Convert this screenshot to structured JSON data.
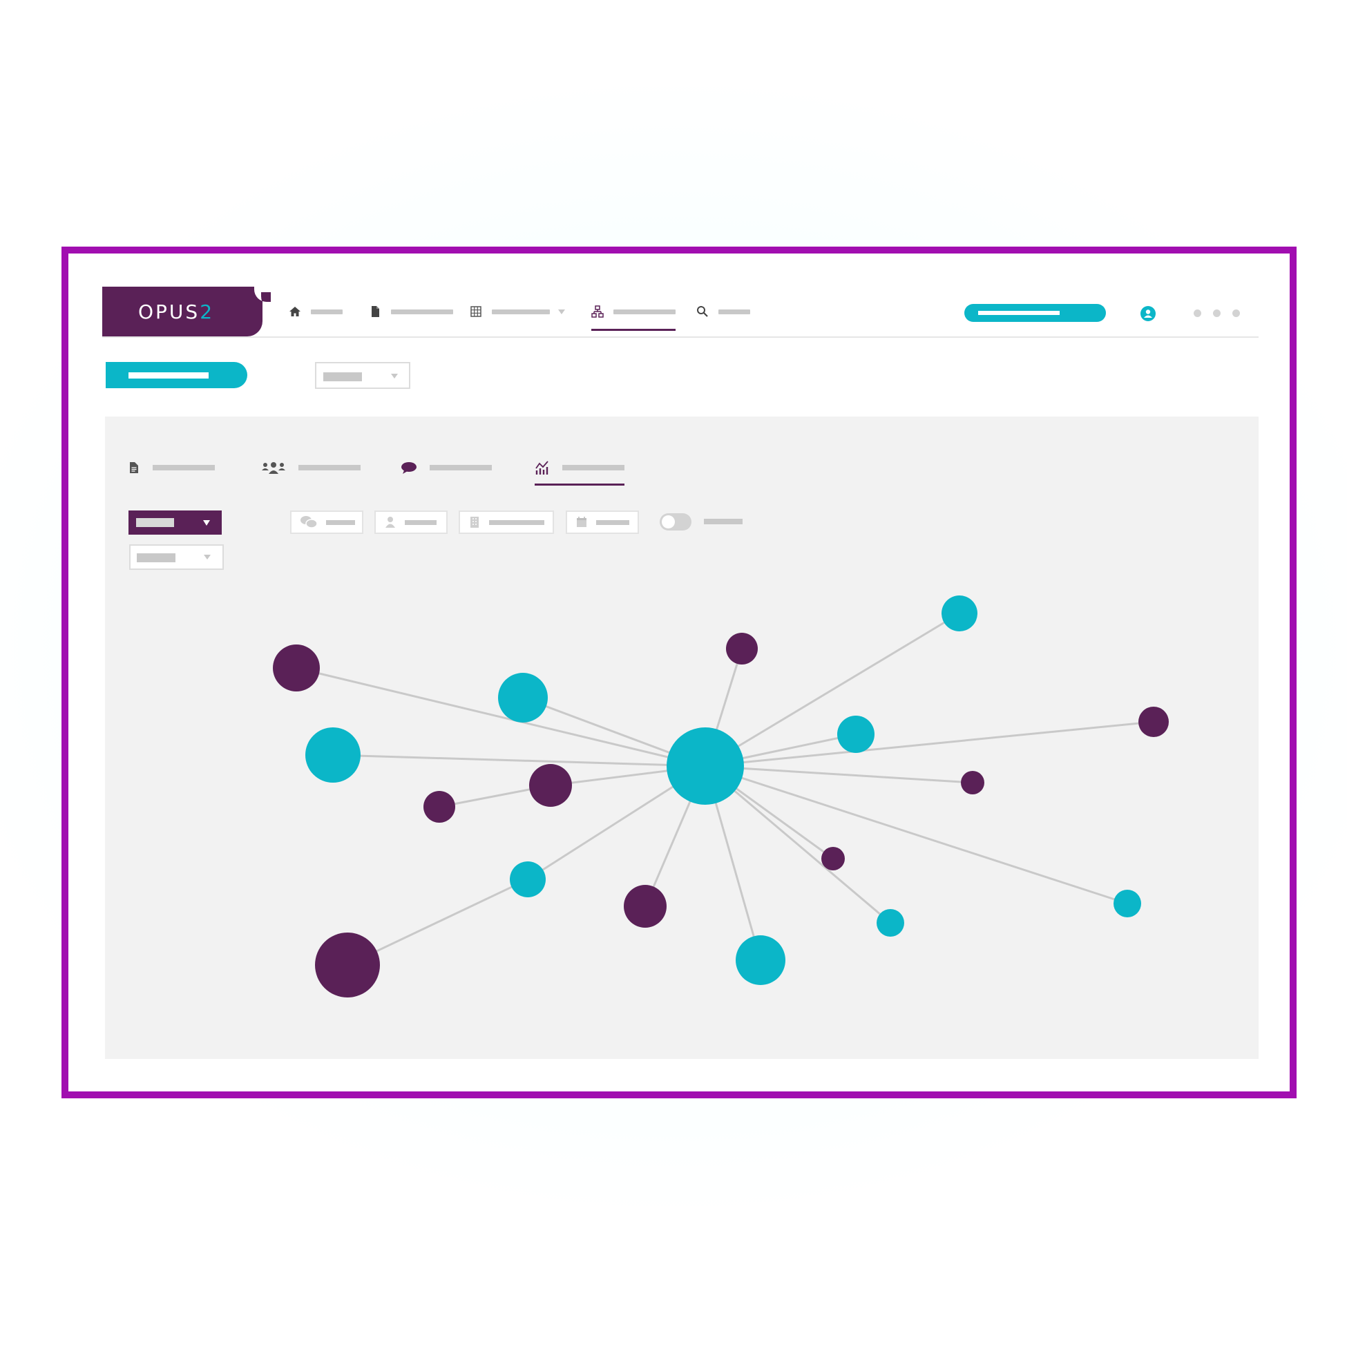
{
  "header": {
    "logo": {
      "text": "OPUS",
      "accent": "2"
    },
    "nav": [
      {
        "icon": "home-icon"
      },
      {
        "icon": "document-icon"
      },
      {
        "icon": "grid-icon"
      },
      {
        "icon": "network-icon",
        "active": true
      },
      {
        "icon": "search-icon"
      }
    ]
  },
  "panel": {
    "tabs": [
      {
        "icon": "document-list-icon"
      },
      {
        "icon": "people-icon"
      },
      {
        "icon": "chat-bubble-icon"
      },
      {
        "icon": "analytics-icon",
        "active": true
      }
    ],
    "filters": [
      {
        "icon": "conversation-icon"
      },
      {
        "icon": "person-icon"
      },
      {
        "icon": "building-icon"
      },
      {
        "icon": "calendar-icon"
      }
    ]
  },
  "colors": {
    "purple": "#5a2157",
    "teal": "#0bb6c8",
    "frame": "#a10eb0",
    "edge": "#c9c9c9"
  }
}
